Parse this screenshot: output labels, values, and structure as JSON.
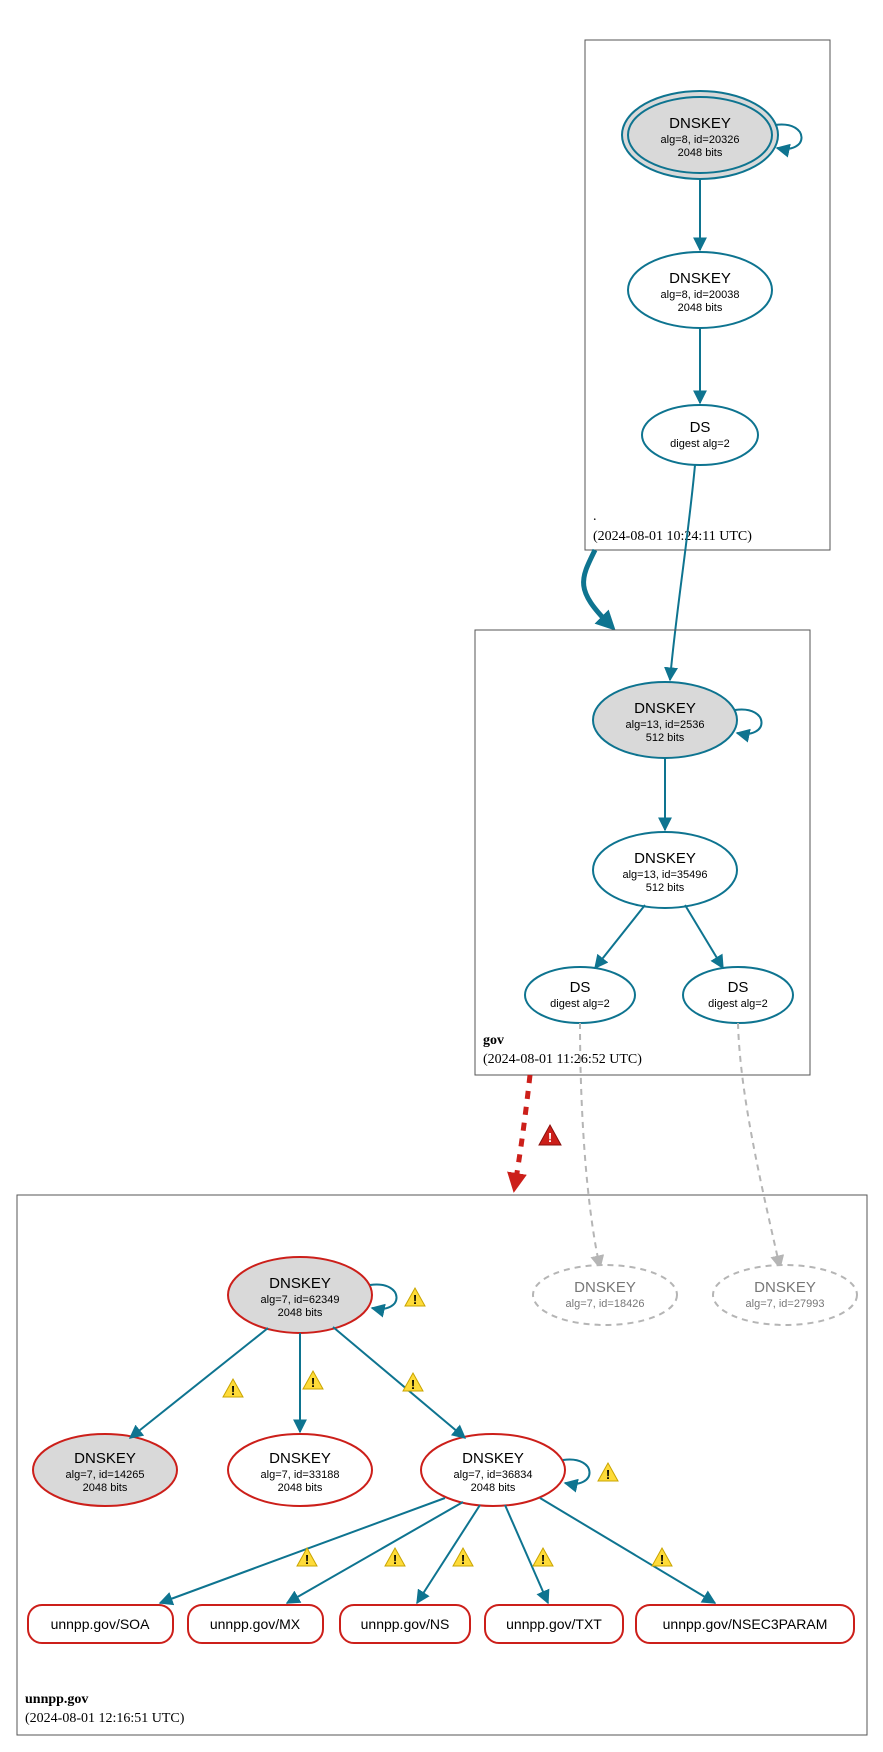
{
  "colors": {
    "teal": "#0e7490",
    "red": "#cc1f1a",
    "gray": "#b5b5b5",
    "ksk_fill": "#d9d9d9"
  },
  "zones": {
    "root": {
      "name": ".",
      "timestamp": "(2024-08-01 10:24:11 UTC)",
      "nodes": {
        "ksk": {
          "title": "DNSKEY",
          "detail": "alg=8, id=20326",
          "bits": "2048 bits"
        },
        "zsk": {
          "title": "DNSKEY",
          "detail": "alg=8, id=20038",
          "bits": "2048 bits"
        },
        "ds": {
          "title": "DS",
          "detail": "digest alg=2"
        }
      }
    },
    "gov": {
      "name": "gov",
      "timestamp": "(2024-08-01 11:26:52 UTC)",
      "nodes": {
        "ksk": {
          "title": "DNSKEY",
          "detail": "alg=13, id=2536",
          "bits": "512 bits"
        },
        "zsk": {
          "title": "DNSKEY",
          "detail": "alg=13, id=35496",
          "bits": "512 bits"
        },
        "ds1": {
          "title": "DS",
          "detail": "digest alg=2"
        },
        "ds2": {
          "title": "DS",
          "detail": "digest alg=2"
        }
      }
    },
    "unnpp": {
      "name": "unnpp.gov",
      "timestamp": "(2024-08-01 12:16:51 UTC)",
      "nodes": {
        "ksk": {
          "title": "DNSKEY",
          "detail": "alg=7, id=62349",
          "bits": "2048 bits"
        },
        "k14265": {
          "title": "DNSKEY",
          "detail": "alg=7, id=14265",
          "bits": "2048 bits"
        },
        "k33188": {
          "title": "DNSKEY",
          "detail": "alg=7, id=33188",
          "bits": "2048 bits"
        },
        "k36834": {
          "title": "DNSKEY",
          "detail": "alg=7, id=36834",
          "bits": "2048 bits"
        },
        "k18426": {
          "title": "DNSKEY",
          "detail": "alg=7, id=18426"
        },
        "k27993": {
          "title": "DNSKEY",
          "detail": "alg=7, id=27993"
        }
      },
      "rr": {
        "soa": "unnpp.gov/SOA",
        "mx": "unnpp.gov/MX",
        "ns": "unnpp.gov/NS",
        "txt": "unnpp.gov/TXT",
        "nsec3param": "unnpp.gov/NSEC3PARAM"
      }
    }
  }
}
